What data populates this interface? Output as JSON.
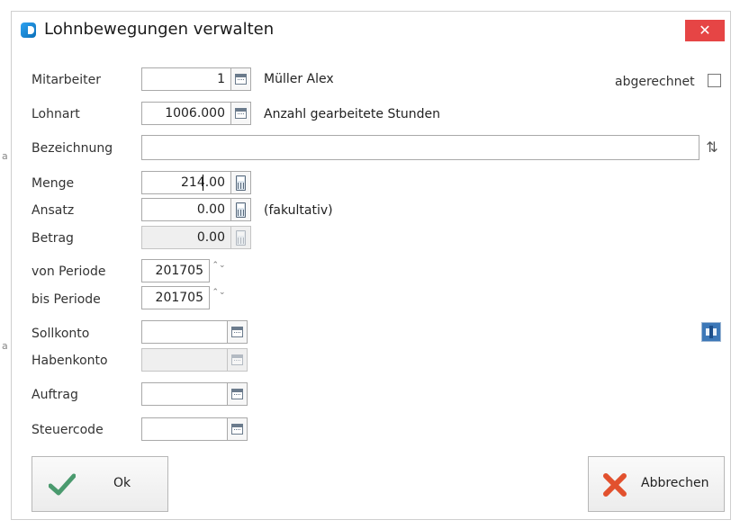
{
  "window": {
    "title": "Lohnbewegungen verwalten",
    "close_glyph": "✕"
  },
  "edge": {
    "marks": [
      "a",
      "a"
    ]
  },
  "fields": {
    "mitarbeiter": {
      "label": "Mitarbeiter",
      "value": "1",
      "name_text": "Müller Alex"
    },
    "abgerechnet": {
      "label": "abgerechnet",
      "checked": false
    },
    "lohnart": {
      "label": "Lohnart",
      "value": "1006.000",
      "desc": "Anzahl gearbeitete Stunden"
    },
    "bezeichnung": {
      "label": "Bezeichnung",
      "value": ""
    },
    "menge": {
      "label": "Menge",
      "value": "214.00"
    },
    "ansatz": {
      "label": "Ansatz",
      "value": "0.00",
      "hint": "(fakultativ)"
    },
    "betrag": {
      "label": "Betrag",
      "value": "0.00"
    },
    "von_periode": {
      "label": "von Periode",
      "value": "201705"
    },
    "bis_periode": {
      "label": "bis Periode",
      "value": "201705"
    },
    "sollkonto": {
      "label": "Sollkonto",
      "value": ""
    },
    "habenkonto": {
      "label": "Habenkonto",
      "value": ""
    },
    "auftrag": {
      "label": "Auftrag",
      "value": ""
    },
    "steuercode": {
      "label": "Steuercode",
      "value": ""
    }
  },
  "buttons": {
    "ok": {
      "label": "Ok",
      "icon": "checkmark-icon",
      "color": "#4a9a6e"
    },
    "cancel": {
      "label": "Abbrechen",
      "icon": "x-icon",
      "color": "#e2512e"
    }
  },
  "icons": {
    "spin": "⌃⌄",
    "sort": "⇅"
  },
  "colors": {
    "close": "#e64545",
    "accent": "#2ea3f2"
  }
}
